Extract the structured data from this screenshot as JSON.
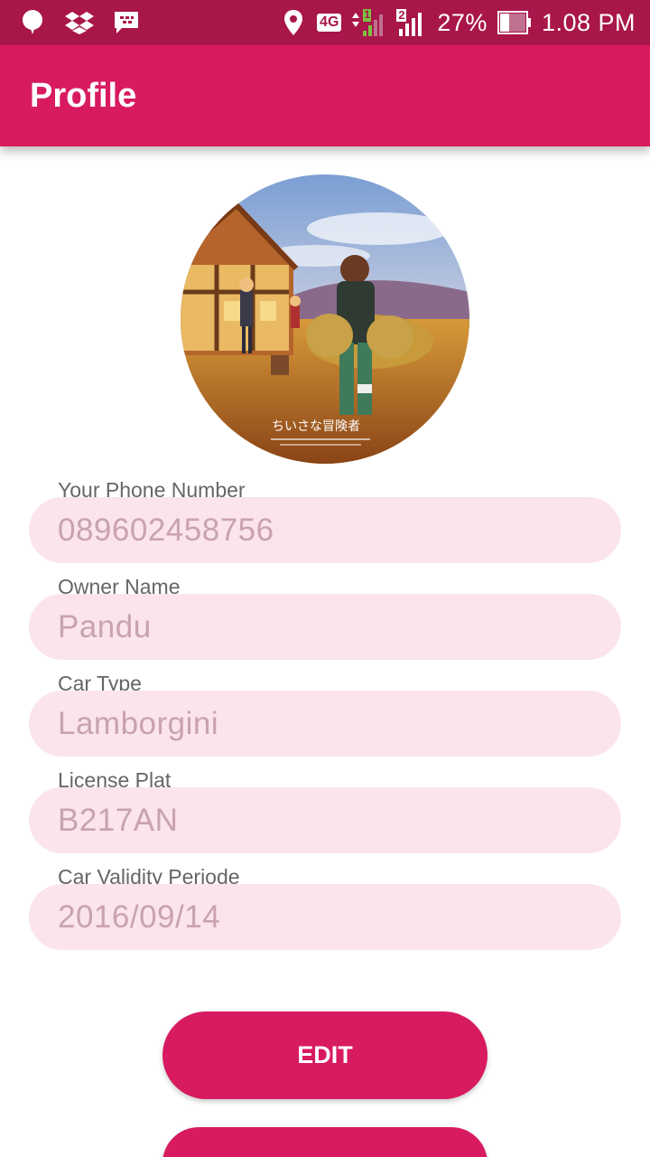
{
  "status_bar": {
    "left_icons": [
      "notification-balloon-icon",
      "dropbox-icon",
      "bbm-icon"
    ],
    "network_label": "4G",
    "sim1_label": "1",
    "sim2_label": "2",
    "battery_text": "27%",
    "time": "1.08 PM",
    "bg_color": "#a8164a"
  },
  "app_bar": {
    "title": "Profile",
    "color": "#d81b60"
  },
  "avatar": {
    "caption": "ちいさな冒険者"
  },
  "fields": [
    {
      "label": "Your Phone Number",
      "value": "089602458756"
    },
    {
      "label": "Owner Name",
      "value": "Pandu"
    },
    {
      "label": "Car Type",
      "value": "Lamborgini"
    },
    {
      "label": "License Plat",
      "value": "B217AN"
    },
    {
      "label": "Car Validity Periode",
      "value": "2016/09/14"
    }
  ],
  "buttons": {
    "edit_label": "EDIT",
    "second_label": ""
  },
  "colors": {
    "accent": "#d81b60",
    "field_bg": "#fbe4ec",
    "field_text": "#c9a2b0"
  }
}
